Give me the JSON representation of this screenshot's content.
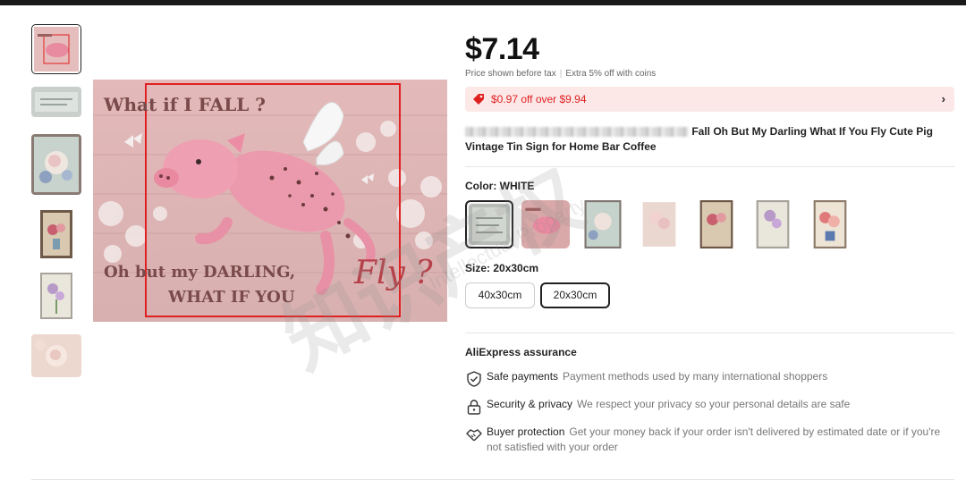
{
  "product": {
    "price": "$7.14",
    "price_note": "Price shown before tax",
    "price_extra": "Extra 5% off with coins",
    "coupon": "$0.97 off over $9.94",
    "title": "Fall Oh But My Darling What If You Fly Cute Pig Vintage Tin Sign for Home Bar Coffee"
  },
  "sign": {
    "line1": "What if I FALL ?",
    "line2": "Oh but my DARLING,",
    "line3": "WHAT IF YOU",
    "script_word": "Fly ?"
  },
  "color": {
    "label": "Color: WHITE",
    "swatches": [
      "white",
      "pig",
      "rose",
      "pink-flowers",
      "vase-roses",
      "lilac",
      "bouquet"
    ]
  },
  "size": {
    "label": "Size: 20x30cm",
    "options": [
      "40x30cm",
      "20x30cm"
    ],
    "selected": "20x30cm"
  },
  "assurance": {
    "title": "AliExpress assurance",
    "items": [
      {
        "icon": "shield-check-icon",
        "label": "Safe payments",
        "desc": "Payment methods used by many international shoppers"
      },
      {
        "icon": "lock-icon",
        "label": "Security & privacy",
        "desc": "We respect your privacy so your personal details are safe"
      },
      {
        "icon": "handshake-icon",
        "label": "Buyer protection",
        "desc": "Get your money back if your order isn't delivered by estimated date or if you're not satisfied with your order"
      }
    ]
  },
  "colors": {
    "accent": "#e02020",
    "coupon_bg": "#fde8e8",
    "selection_border": "#222222"
  },
  "watermark": {
    "line1": "知识产权",
    "line2": "Intellectual Property"
  }
}
